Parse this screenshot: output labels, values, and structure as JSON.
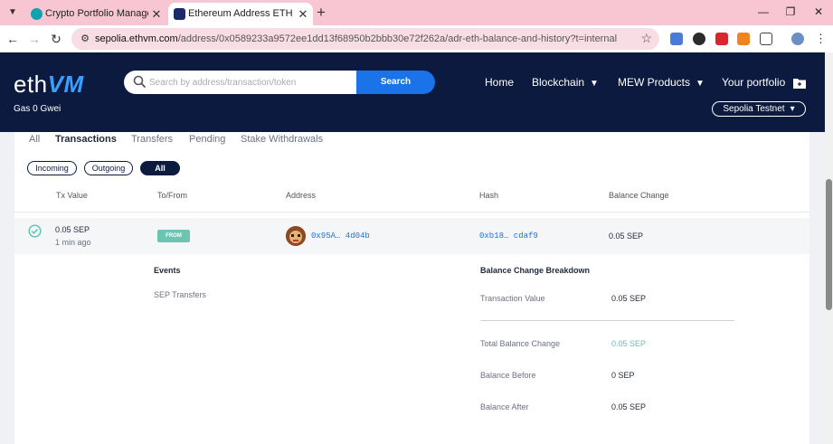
{
  "browser": {
    "tabs": [
      {
        "title": "Crypto Portfolio Manager | MyE",
        "close": "✕",
        "favicon_color": "#0fa3b1"
      },
      {
        "title": "Ethereum Address ETH Balance",
        "close": "✕",
        "favicon_color": "#1b2a6b"
      }
    ],
    "new_tab": "+",
    "url_host": "sepolia.ethvm.com",
    "url_path": "/address/0x0589233a9572ee1dd13f68950b2bbb30e72f262a/adr-eth-balance-and-history?t=internal",
    "window_controls": {
      "minimize": "—",
      "maximize": "❐",
      "close": "✕"
    }
  },
  "site": {
    "logo_eth": "eth",
    "logo_vm": "VM",
    "gas": "Gas 0 Gwei",
    "search": {
      "placeholder": "Search by address/transaction/token",
      "button": "Search"
    },
    "nav": [
      "Home",
      "Blockchain",
      "MEW Products",
      "Your portfolio"
    ],
    "network": "Sepolia Testnet"
  },
  "subtabs": [
    "All",
    "Transactions",
    "Transfers",
    "Pending",
    "Stake Withdrawals"
  ],
  "active_subtab": "Transactions",
  "filters": [
    "Incoming",
    "Outgoing",
    "All"
  ],
  "active_filter": "All",
  "table": {
    "headers": [
      "Tx Value",
      "To/From",
      "Address",
      "Hash",
      "Balance Change"
    ],
    "row": {
      "tx_value": "0.05 SEP",
      "time": "1 min ago",
      "direction": "FROM",
      "address": "0x95A… 4d04b",
      "hash": "0xb18… cdaf9",
      "balance_change": "0.05 SEP"
    }
  },
  "details": {
    "events_title": "Events",
    "events_item": "SEP Transfers",
    "breakdown_title": "Balance Change Breakdown",
    "rows": [
      {
        "label": "Transaction Value",
        "value": "0.05 SEP"
      },
      {
        "label": "Total Balance Change",
        "value": "0.05 SEP"
      },
      {
        "label": "Balance Before",
        "value": "0 SEP"
      },
      {
        "label": "Balance After",
        "value": "0.05 SEP"
      }
    ]
  },
  "colors": {
    "header_bg": "#0b1a3e",
    "search_button": "#1a73e8",
    "from_badge": "#6cc5b3",
    "positive": "#5cc3b0",
    "tabbar": "#f7c6d2"
  }
}
